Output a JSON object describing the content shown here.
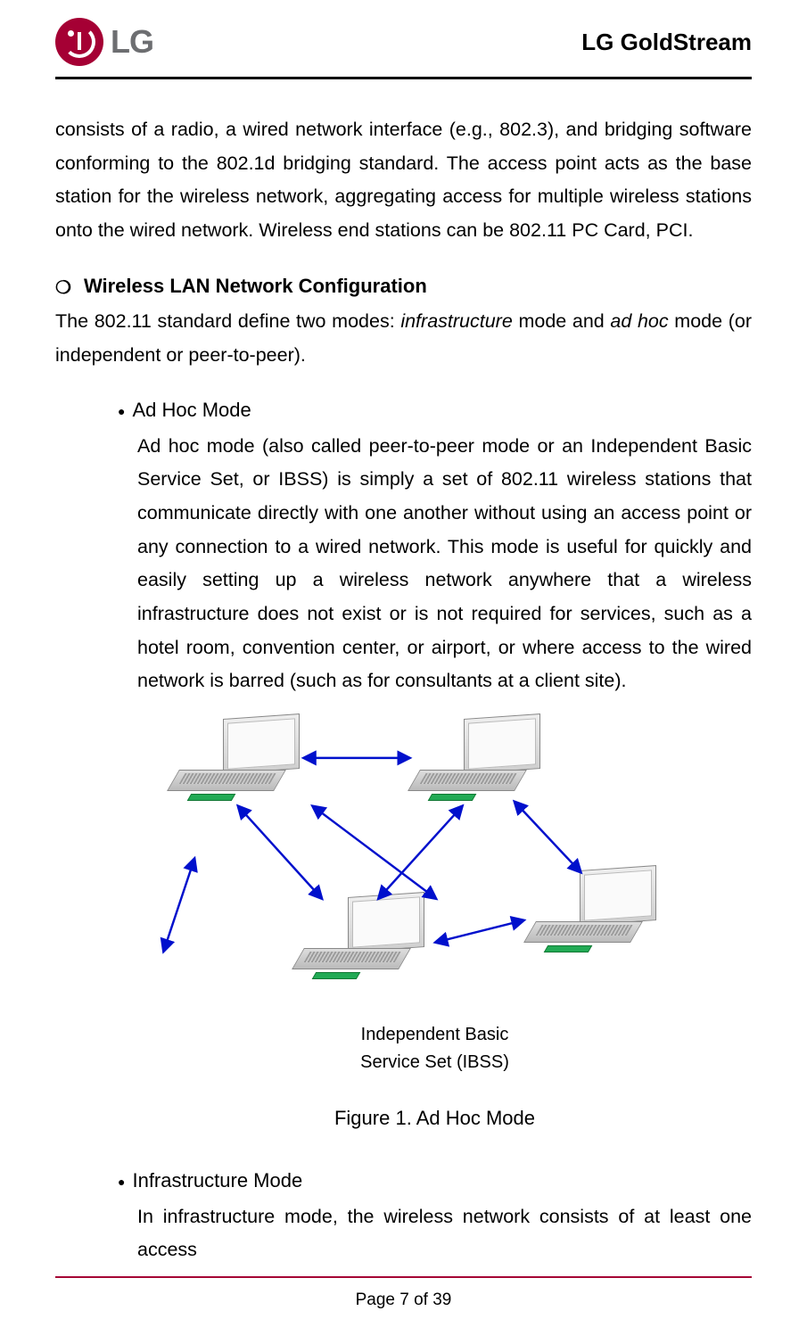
{
  "header": {
    "logo_text": "LG",
    "brand": "LG GoldStream"
  },
  "body": {
    "intro_paragraph": "consists of a radio, a wired network interface (e.g., 802.3), and bridging software conforming to the 802.1d bridging standard. The access point acts as the base station for the wireless network, aggregating access for multiple wireless stations onto the wired network. Wireless end stations can be 802.11 PC Card, PCI.",
    "section": {
      "bullet": "❍",
      "title": "Wireless LAN Network Configuration",
      "intro_pre": "The 802.11 standard define two modes: ",
      "intro_mode1": "infrastructure",
      "intro_mid1": " mode and ",
      "intro_mode2": "ad hoc",
      "intro_post": " mode (or independent or peer-to-peer)."
    },
    "adhoc": {
      "bullet": "●",
      "title": "Ad Hoc Mode",
      "body": "Ad hoc mode (also called peer-to-peer mode or an Independent Basic Service Set, or IBSS) is simply a set of 802.11 wireless stations that communicate directly with one another without using an access point or any connection to a wired network. This mode is useful for quickly and easily setting up a wireless network anywhere that a wireless infrastructure does not exist or is not required for services, such as a hotel room, convention center, or airport, or where access to the wired network is barred (such as for consultants at a client site)."
    },
    "diagram": {
      "caption_line1": "Independent Basic",
      "caption_line2": "Service Set (IBSS)",
      "figure_title": "Figure 1.  Ad Hoc Mode"
    },
    "infra": {
      "bullet": "●",
      "title": "Infrastructure Mode",
      "body": "In infrastructure mode, the wireless network consists of at least one access"
    }
  },
  "footer": {
    "page": "Page 7 of 39"
  }
}
